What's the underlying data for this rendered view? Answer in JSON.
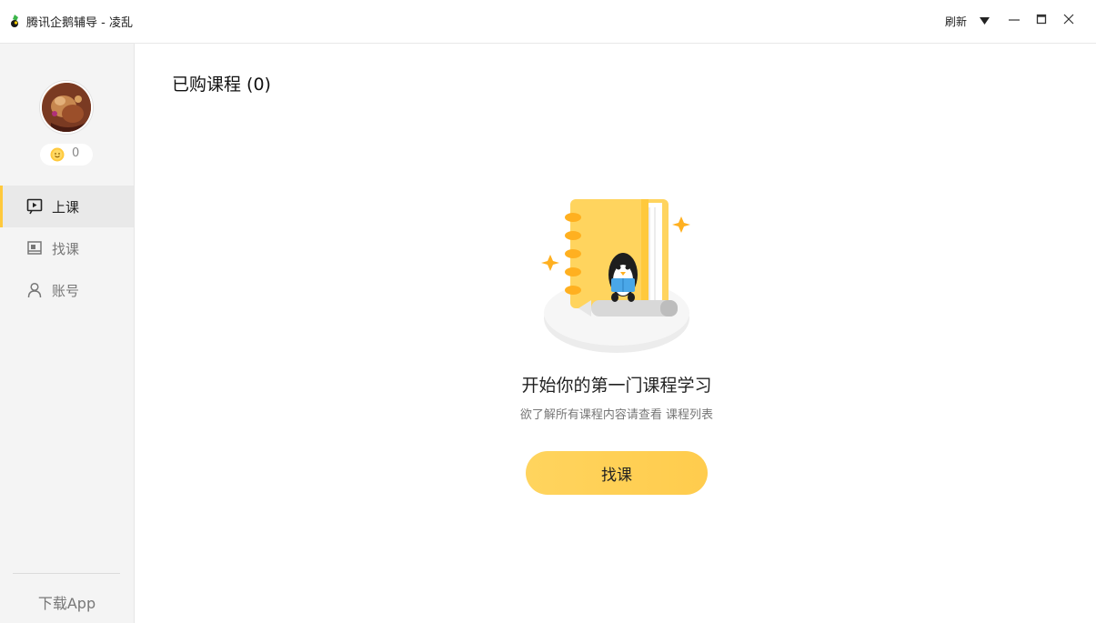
{
  "window": {
    "title": "腾讯企鹅辅导 - 凌乱",
    "refresh_label": "刷新"
  },
  "sidebar": {
    "coins": "0",
    "items": [
      {
        "label": "上课",
        "icon": "play-board-icon",
        "active": true
      },
      {
        "label": "找课",
        "icon": "book-icon",
        "active": false
      },
      {
        "label": "账号",
        "icon": "user-icon",
        "active": false
      }
    ],
    "download_label": "下载App"
  },
  "main": {
    "title": "已购课程 (0)",
    "empty_title": "开始你的第一门课程学习",
    "empty_subtitle": "欲了解所有课程内容请查看 课程列表",
    "cta_label": "找课"
  },
  "colors": {
    "accent": "#ffc93c",
    "sidebar_bg": "#f4f4f4"
  }
}
